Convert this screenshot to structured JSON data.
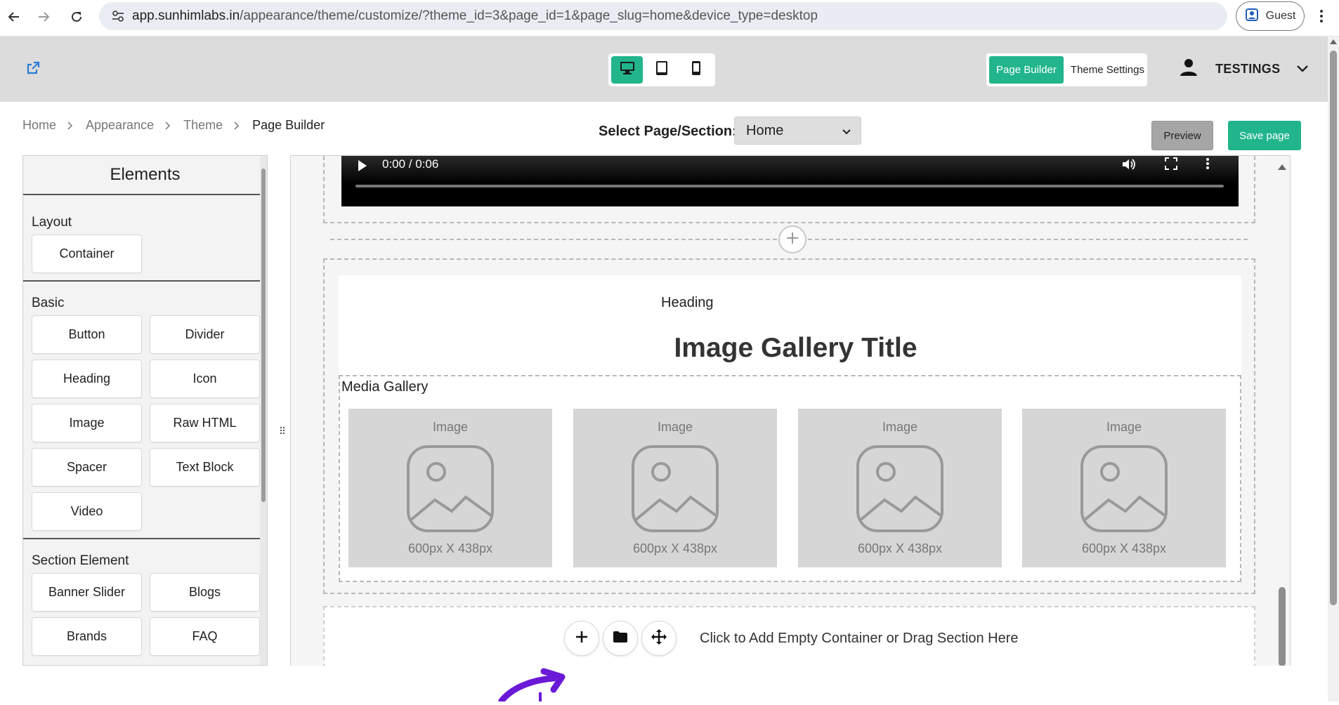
{
  "browser": {
    "url_host": "app.sunhimlabs.in",
    "url_path": "/appearance/theme/customize/?theme_id=3&page_id=1&page_slug=home&device_type=desktop",
    "profile_label": "Guest",
    "icons": {
      "back": "arrow-left-icon",
      "forward": "arrow-right-icon",
      "reload": "reload-icon",
      "site_info": "tune-icon",
      "profile": "profile-icon",
      "menu": "kebab-menu-icon"
    }
  },
  "header": {
    "device_buttons": [
      {
        "icon": "desktop-icon",
        "active": true
      },
      {
        "icon": "tablet-icon",
        "active": false
      },
      {
        "icon": "mobile-icon",
        "active": false
      }
    ],
    "mode_buttons": {
      "page_builder": "Page Builder",
      "theme_settings": "Theme Settings"
    },
    "user_name": "TESTINGS",
    "accent": "#22b58c"
  },
  "breadcrumb": {
    "items": [
      "Home",
      "Appearance",
      "Theme"
    ],
    "current": "Page Builder"
  },
  "page_select": {
    "label": "Select Page/Section:",
    "value": "Home"
  },
  "actions": {
    "preview": "Preview",
    "save": "Save page"
  },
  "elements_panel": {
    "title": "Elements",
    "groups": [
      {
        "title": "Layout",
        "items": [
          "Container"
        ]
      },
      {
        "title": "Basic",
        "items": [
          "Button",
          "Divider",
          "Heading",
          "Icon",
          "Image",
          "Raw HTML",
          "Spacer",
          "Text Block",
          "Video"
        ]
      },
      {
        "title": "Section Element",
        "items": [
          "Banner Slider",
          "Blogs",
          "Brands",
          "FAQ"
        ]
      }
    ]
  },
  "canvas": {
    "video": {
      "time": "0:00 / 0:06"
    },
    "heading_text": "Heading",
    "gallery_title": "Image Gallery Title",
    "media_gallery_label": "Media Gallery",
    "tiles": [
      {
        "label": "Image",
        "size": "600px X 438px"
      },
      {
        "label": "Image",
        "size": "600px X 438px"
      },
      {
        "label": "Image",
        "size": "600px X 438px"
      },
      {
        "label": "Image",
        "size": "600px X 438px"
      }
    ],
    "add_section_text": "Click to Add Empty Container or Drag Section Here"
  }
}
